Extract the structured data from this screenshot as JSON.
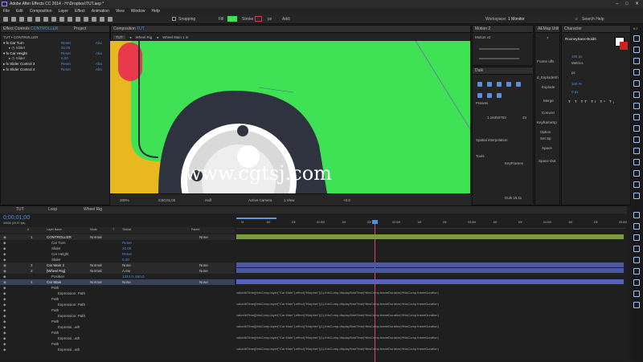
{
  "title": "Adobe After Effects CC 2014 - H:\\Dropbox\\TUT.aep *",
  "window_controls": [
    "–",
    "□",
    "✕"
  ],
  "menu": [
    "File",
    "Edit",
    "Composition",
    "Layer",
    "Effect",
    "Animation",
    "View",
    "Window",
    "Help"
  ],
  "toolbar": {
    "snapping": "Snapping",
    "fill": "Fill",
    "stroke": "Stroke",
    "px": "px",
    "add": "Add:",
    "workspace_label": "Workspace:",
    "workspace_value": "1 Monitor",
    "search": "Search Help"
  },
  "effect_controls": {
    "tab": "Effect Controls",
    "tab_target": "CONTROLLER",
    "project_tab": "Project",
    "breadcrumb": "TUT • CONTROLLER",
    "items": [
      {
        "name": "Car Turn",
        "reset": "Reset",
        "about": "Abo"
      },
      {
        "name": "Slider",
        "value": "20.00"
      },
      {
        "name": "Car Height",
        "reset": "Reset",
        "about": "Abo"
      },
      {
        "name": "Slider",
        "value": "0.00"
      },
      {
        "name": "Slider Control 3",
        "reset": "Reset",
        "about": "Abo"
      },
      {
        "name": "Slider Control 4",
        "reset": "Reset",
        "about": "Abo"
      }
    ]
  },
  "composition": {
    "tab": "Composition",
    "tab_target": "TUT",
    "crumbs": [
      "TUT",
      "Wheel Rig",
      "Wheel Main 1 in"
    ],
    "zoom": "200%",
    "timecode": "0;00;01;00",
    "resolution": "Half",
    "camera": "Active Camera",
    "view": "1 View",
    "exposure": "+0.0"
  },
  "watermark": "www.cgtsj.com",
  "motion": {
    "title": "Motion 2",
    "version": "Motion v2"
  },
  "duik": {
    "title": "Duik",
    "presets": "Presets",
    "value": "1.16350753",
    "value2": "33",
    "spatial": "Spatial interpolation",
    "tools": "Tools",
    "keyframes": "KeyFrames",
    "version": "Duik 15.11"
  },
  "aemap": {
    "title": "AEMap Utili",
    "value": "7",
    "rig": "Frame offs",
    "subtitle": "d_ExplodeSh",
    "explode": "Explode",
    "merge": "Merge",
    "convert": "Convert",
    "keyframe": "KeyframeSp",
    "option": "Option",
    "set": "Set Sp",
    "space": "Space",
    "spaceout": "Space Out"
  },
  "character": {
    "title": "Character",
    "font": "RooneySans-BoldIt",
    "size": "105 px",
    "tracking": "Metrics",
    "px": "px",
    "size2": "100 %",
    "px2": "0 px"
  },
  "timeline": {
    "tabs": [
      "TUT",
      "Loop",
      "Wheel Rig"
    ],
    "timecode": "0;00;01;00",
    "fps": "00030 (29.97 fps)",
    "columns": [
      "#",
      "Layer Name",
      "Mode",
      "T",
      "TrkMat",
      "Parent"
    ],
    "time_labels": [
      "0f",
      "10f",
      "20f",
      "01:00f",
      "10f",
      "20f",
      "02:00f",
      "10f",
      "20f",
      "03:00f",
      "10f",
      "20f",
      "04:00f",
      "10f",
      "20f",
      "05:00f"
    ],
    "layers": [
      {
        "num": "1",
        "name": "CONTROLLER",
        "mode": "Normal",
        "trk": "",
        "parent": "None"
      },
      {
        "num": "",
        "name": "Car Turn",
        "mode": "",
        "trk": "Reset",
        "parent": ""
      },
      {
        "num": "",
        "name": "Slider",
        "mode": "",
        "trk": "20.00",
        "parent": ""
      },
      {
        "num": "",
        "name": "Car Height",
        "mode": "",
        "trk": "Reset",
        "parent": ""
      },
      {
        "num": "",
        "name": "Slider",
        "mode": "",
        "trk": "0.00",
        "parent": ""
      },
      {
        "num": "2",
        "name": "Car Main 2",
        "mode": "Normal",
        "trk": "None",
        "parent": "None"
      },
      {
        "num": "3",
        "name": "[Wheel Rig]",
        "mode": "Normal",
        "trk": "A.Inv",
        "parent": "None"
      },
      {
        "num": "",
        "name": "Position",
        "mode": "",
        "trk": "1324.0, 550.0",
        "parent": ""
      },
      {
        "num": "4",
        "name": "Car Main",
        "mode": "Normal",
        "trk": "None",
        "parent": "None"
      },
      {
        "num": "",
        "name": "Path",
        "mode": "",
        "trk": "",
        "parent": ""
      },
      {
        "num": "",
        "name": "Expression: Path",
        "mode": "",
        "trk": "",
        "parent": ""
      },
      {
        "num": "",
        "name": "Path",
        "mode": "",
        "trk": "",
        "parent": ""
      },
      {
        "num": "",
        "name": "Expression: Path",
        "mode": "",
        "trk": "",
        "parent": ""
      },
      {
        "num": "",
        "name": "Path",
        "mode": "",
        "trk": "",
        "parent": ""
      },
      {
        "num": "",
        "name": "Expression: Path",
        "mode": "",
        "trk": "",
        "parent": ""
      },
      {
        "num": "",
        "name": "Path",
        "mode": "",
        "trk": "",
        "parent": ""
      },
      {
        "num": "",
        "name": "Expressi...ath",
        "mode": "",
        "trk": "",
        "parent": ""
      },
      {
        "num": "",
        "name": "Path",
        "mode": "",
        "trk": "",
        "parent": ""
      },
      {
        "num": "",
        "name": "Expressi...ath",
        "mode": "",
        "trk": "",
        "parent": ""
      },
      {
        "num": "",
        "name": "Path",
        "mode": "",
        "trk": "",
        "parent": ""
      },
      {
        "num": "",
        "name": "Expressi...ath",
        "mode": "",
        "trk": "",
        "parent": ""
      }
    ],
    "expression": "valueAtTime([thisComp.layer(\"Car Main\").effect(\"Morpher\")(1)-thisComp.displayStartTime)*thisComp.frameDuration)*thisComp.frameDuration)"
  },
  "colors": {
    "canvas": "#3ee254",
    "accent": "#4d8fe0",
    "track_green": "#7a9a3c",
    "track_blue": "#4b5aa0",
    "playhead": "#e04070"
  }
}
